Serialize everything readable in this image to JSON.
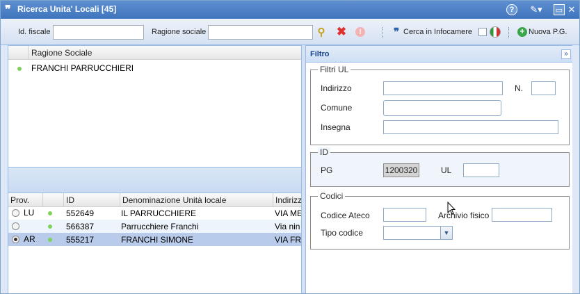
{
  "window": {
    "title": "Ricerca Unita' Locali [45]",
    "quote_glyph": "❞"
  },
  "toolbar": {
    "fiscal_id_label": "Id. fiscale",
    "fiscal_id_value": "",
    "company_name_label": "Ragione sociale",
    "company_name_value": "",
    "infocamere_label": "Cerca in Infocamere",
    "new_pg_label": "Nuova P.G."
  },
  "top_grid": {
    "columns": [
      "Ragione Sociale"
    ],
    "rows": [
      {
        "name": "FRANCHI PARRUCCHIERI"
      }
    ]
  },
  "bottom_grid": {
    "columns": [
      "Prov.",
      "",
      "ID",
      "Denominazione Unità locale",
      "Indirizz"
    ],
    "rows": [
      {
        "prov": "LU",
        "id": "552649",
        "name": "IL PARRUCCHIERE",
        "address": "VIA ME",
        "selected": false
      },
      {
        "prov": "",
        "id": "566387",
        "name": "Parrucchiere Franchi",
        "address": "Via nin",
        "selected": false
      },
      {
        "prov": "AR",
        "id": "555217",
        "name": "FRANCHI SIMONE",
        "address": "VIA FR",
        "selected": true
      }
    ]
  },
  "filter": {
    "title": "Filtro",
    "ul": {
      "legend": "Filtri UL",
      "address_label": "Indirizzo",
      "number_label": "N.",
      "town_label": "Comune",
      "sign_label": "Insegna"
    },
    "id": {
      "legend": "ID",
      "pg_label": "PG",
      "pg_value": "1200320",
      "ul_label": "UL",
      "ul_value": ""
    },
    "codes": {
      "legend": "Codici",
      "ateco_label": "Codice Ateco",
      "archive_label": "Archivio fisico",
      "code_type_label": "Tipo codice"
    }
  },
  "colors": {
    "title_bar": "#3f74bd",
    "border": "#99bbe8",
    "selected_row": "#b9cbea",
    "status_dot": "#7dd25a"
  }
}
